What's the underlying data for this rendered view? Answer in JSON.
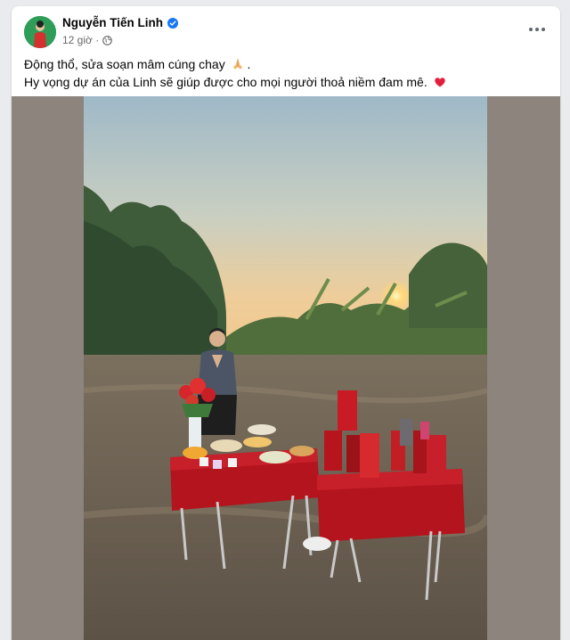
{
  "post": {
    "author": "Nguyễn Tiến Linh",
    "time": "12 giờ ·",
    "text_line1": "Động thổ, sửa soạn mâm cúng chay",
    "text_line2": "Hy vọng dự án của Linh sẽ giúp được cho mọi người thoả niềm đam mê.",
    "icons": {
      "verified": "verified-badge-icon",
      "privacy": "globe-icon",
      "options": "more-options-icon",
      "emoji1": "folded-hands-emoji",
      "emoji2": "red-heart-emoji"
    }
  },
  "colors": {
    "accent": "#1877f2",
    "heart": "#e41e3f",
    "meta_text": "#65676b"
  }
}
